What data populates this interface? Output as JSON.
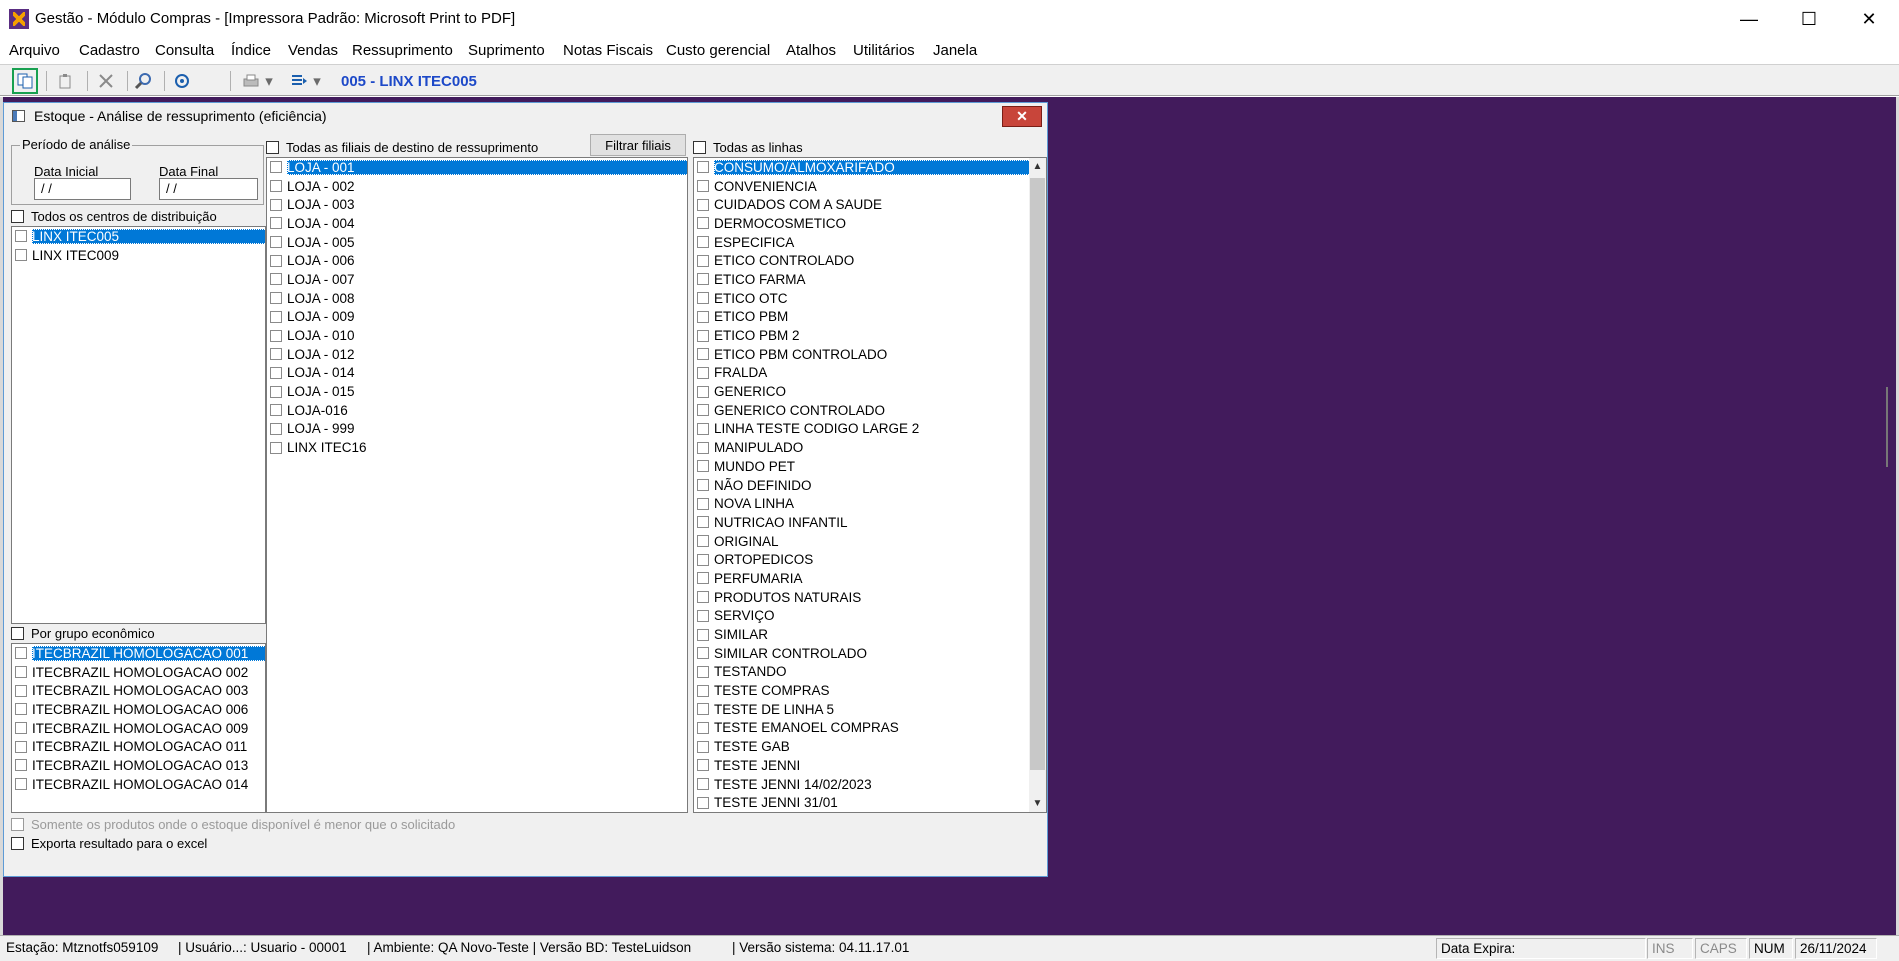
{
  "window": {
    "title": "Gestão  - Módulo Compras - [Impressora Padrão: Microsoft Print to PDF]",
    "minimize": "—",
    "maximize": "☐",
    "close": "✕"
  },
  "menu": [
    "Arquivo",
    "Cadastro",
    "Consulta",
    "Índice",
    "Vendas",
    "Ressuprimento",
    "Suprimento",
    "Notas Fiscais",
    "Custo gerencial",
    "Atalhos",
    "Utilitários",
    "Janela"
  ],
  "toolbar": {
    "label": "005 - LINX ITEC005",
    "icons": [
      "copy-icon",
      "paste-icon",
      "delete-icon",
      "search-icon",
      "power-icon",
      "printer-icon",
      "export-icon"
    ]
  },
  "child_window": {
    "title": "Estoque - Análise de ressuprimento (eficiência)",
    "close": "✕"
  },
  "periodo": {
    "legend": "Período de análise",
    "data_inicial_label": "Data Inicial",
    "data_inicial_value": " /  /",
    "data_final_label": "Data Final",
    "data_final_value": " /  /"
  },
  "centros": {
    "check_label": "Todos os centros de distribuição",
    "items": [
      "LINX ITEC005",
      "LINX ITEC009"
    ]
  },
  "grupo": {
    "check_label": "Por grupo econômico",
    "items": [
      "ITECBRAZIL HOMOLOGACAO 001",
      "ITECBRAZIL HOMOLOGACAO 002",
      "ITECBRAZIL HOMOLOGACAO 003",
      "ITECBRAZIL HOMOLOGACAO 006",
      "ITECBRAZIL HOMOLOGACAO 009",
      "ITECBRAZIL HOMOLOGACAO 011",
      "ITECBRAZIL HOMOLOGACAO 013",
      "ITECBRAZIL HOMOLOGACAO 014"
    ]
  },
  "filiais": {
    "check_label": "Todas as filiais de destino de ressuprimento",
    "filter_button": "Filtrar filiais",
    "items": [
      "LOJA - 001",
      "LOJA - 002",
      "LOJA - 003",
      "LOJA - 004",
      "LOJA - 005",
      "LOJA - 006",
      "LOJA - 007",
      "LOJA - 008",
      "LOJA - 009",
      "LOJA - 010",
      "LOJA - 012",
      "LOJA - 014",
      "LOJA - 015",
      "LOJA-016",
      "LOJA - 999",
      "LINX ITEC16"
    ]
  },
  "linhas": {
    "check_label": "Todas as linhas",
    "items": [
      "CONSUMO/ALMOXARIFADO",
      "CONVENIENCIA",
      "CUIDADOS COM A SAUDE",
      "DERMOCOSMETICO",
      "ESPECIFICA",
      "ETICO CONTROLADO",
      "ETICO FARMA",
      "ETICO OTC",
      "ETICO PBM",
      "ETICO PBM 2",
      "ETICO PBM CONTROLADO",
      "FRALDA",
      "GENERICO",
      "GENERICO CONTROLADO",
      "LINHA TESTE CODIGO LARGE 2",
      "MANIPULADO",
      "MUNDO PET",
      "NÃO DEFINIDO",
      "NOVA LINHA",
      "NUTRICAO INFANTIL",
      "ORIGINAL",
      "ORTOPEDICOS",
      "PERFUMARIA",
      "PRODUTOS NATURAIS",
      "SERVIÇO",
      "SIMILAR",
      "SIMILAR CONTROLADO",
      "TESTANDO",
      "TESTE COMPRAS",
      "TESTE DE LINHA 5",
      "TESTE EMANOEL COMPRAS",
      "TESTE GAB",
      "TESTE JENNI",
      "TESTE JENNI 14/02/2023",
      "TESTE JENNI 31/01"
    ]
  },
  "options": {
    "somente_label": "Somente os produtos onde o estoque disponível é menor que o solicitado",
    "exporta_label": "Exporta resultado para o excel"
  },
  "statusbar": {
    "estacao": "Estação: Mtznotfs059109",
    "usuario": "| Usuário...: Usuario - 00001",
    "ambiente": "| Ambiente: QA Novo-Teste | Versão BD: TesteLuidson",
    "versao": "| Versão sistema: 04.11.17.01",
    "data_expira": "Data Expira:",
    "ins": "INS",
    "caps": "CAPS",
    "num": "NUM",
    "date": "26/11/2024"
  },
  "colors": {
    "mdi_background": "#421b5c",
    "selection": "#0078d7",
    "toolbar_label": "#1d49c8",
    "close_button": "#c8453a"
  }
}
